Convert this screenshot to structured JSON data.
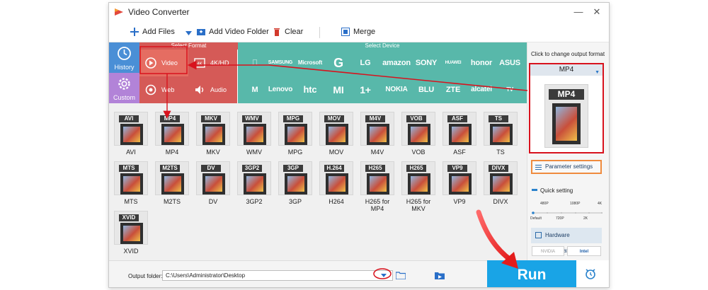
{
  "window": {
    "title": "Video Converter",
    "controls": [
      "—",
      "✕"
    ]
  },
  "toolbar": {
    "add_files": "Add Files",
    "add_video_folder": "Add Video Folder",
    "clear": "Clear",
    "merge": "Merge"
  },
  "left_tabs": [
    {
      "label": "History",
      "color": "#4a8fd6"
    },
    {
      "label": "Custom",
      "color": "#b283d8"
    }
  ],
  "categories": {
    "header": "Select Format",
    "items": [
      {
        "label": "Video",
        "selected": true
      },
      {
        "label": "4K/HD",
        "selected": false
      },
      {
        "label": "Web",
        "selected": false
      },
      {
        "label": "Audio",
        "selected": false
      }
    ]
  },
  "devices": {
    "header": "Select Device",
    "row1": [
      "",
      "SAMSUNG",
      "Microsoft",
      "G",
      "LG",
      "amazon",
      "SONY",
      "HUAWEI",
      "honor",
      "ASUS"
    ],
    "row2": [
      "M",
      "Lenovo",
      "htc",
      "MI",
      "1+",
      "NOKIA",
      "BLU",
      "ZTE",
      "alcatel",
      "TV"
    ]
  },
  "formats": [
    {
      "tag": "AVI",
      "name": "AVI"
    },
    {
      "tag": "MP4",
      "name": "MP4"
    },
    {
      "tag": "MKV",
      "name": "MKV"
    },
    {
      "tag": "WMV",
      "name": "WMV"
    },
    {
      "tag": "MPG",
      "name": "MPG"
    },
    {
      "tag": "MOV",
      "name": "MOV"
    },
    {
      "tag": "M4V",
      "name": "M4V"
    },
    {
      "tag": "VOB",
      "name": "VOB"
    },
    {
      "tag": "ASF",
      "name": "ASF"
    },
    {
      "tag": "TS",
      "name": "TS"
    },
    {
      "tag": "MTS",
      "name": "MTS"
    },
    {
      "tag": "M2TS",
      "name": "M2TS"
    },
    {
      "tag": "DV",
      "name": "DV"
    },
    {
      "tag": "3GP2",
      "name": "3GP2"
    },
    {
      "tag": "3GP",
      "name": "3GP"
    },
    {
      "tag": "H.264",
      "name": "H264"
    },
    {
      "tag": "H265",
      "name": "H265 for MP4"
    },
    {
      "tag": "H265",
      "name": "H265 for MKV"
    },
    {
      "tag": "VP9",
      "name": "VP9"
    },
    {
      "tag": "DIVX",
      "name": "DIVX"
    },
    {
      "tag": "XVID",
      "name": "XVID"
    }
  ],
  "output_panel": {
    "hint": "Click to change output format",
    "selected_format": "MP4",
    "parameter_settings": "Parameter settings",
    "quick_setting": "Quick setting",
    "quality_ticks_top": [
      "480P",
      "1080P",
      "4K"
    ],
    "quality_ticks_bottom": [
      "Default",
      "720P",
      "2K"
    ],
    "hardware_acceleration": "Hardware acceleration",
    "gpu_badges": [
      "NVIDIA",
      "Intel"
    ]
  },
  "bottom": {
    "output_folder_label": "Output folder:",
    "output_folder_path": "C:\\Users\\Administrator\\Desktop",
    "run_label": "Run"
  },
  "colors": {
    "history_tab": "#4a8fd6",
    "custom_tab": "#b283d8",
    "format_category_bg": "#d55a57",
    "device_bg": "#58b8aa",
    "run_button": "#19a4e6",
    "annotation_red": "#d8121d"
  }
}
